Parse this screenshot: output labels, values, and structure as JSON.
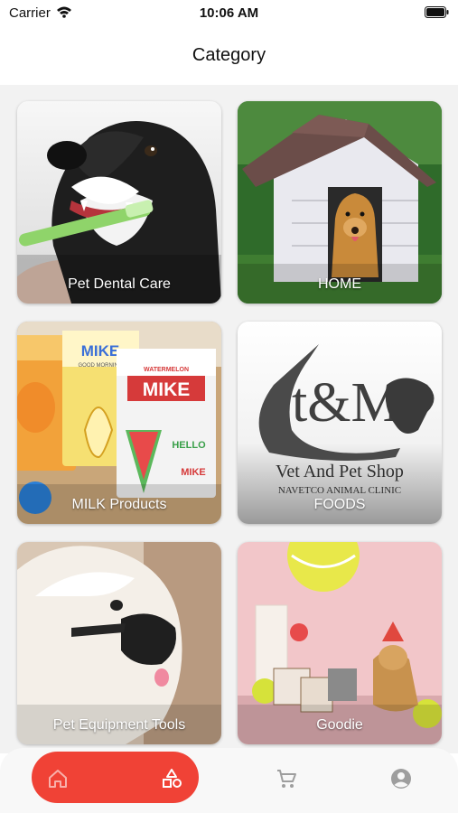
{
  "status_bar": {
    "carrier": "Carrier",
    "time": "10:06 AM"
  },
  "header": {
    "title": "Category"
  },
  "categories": [
    {
      "label": "Pet Dental Care"
    },
    {
      "label": "HOME"
    },
    {
      "label": "MILK Products",
      "art_text": [
        "MIKE",
        "GOOD MORNING",
        "WATERMELON",
        "MIKE",
        "HELLO",
        "MIKE"
      ]
    },
    {
      "label": "FOODS",
      "art_text": [
        "t&M",
        "Vet And Pet Shop",
        "NAVETCO ANIMAL CLINIC"
      ]
    },
    {
      "label": "Pet Equipment Tools"
    },
    {
      "label": "Goodie"
    }
  ],
  "nav": {
    "items": [
      "home-icon",
      "category-icon",
      "cart-icon",
      "account-icon"
    ],
    "active_color": "#f04236",
    "inactive_color": "#9e9e9e"
  }
}
